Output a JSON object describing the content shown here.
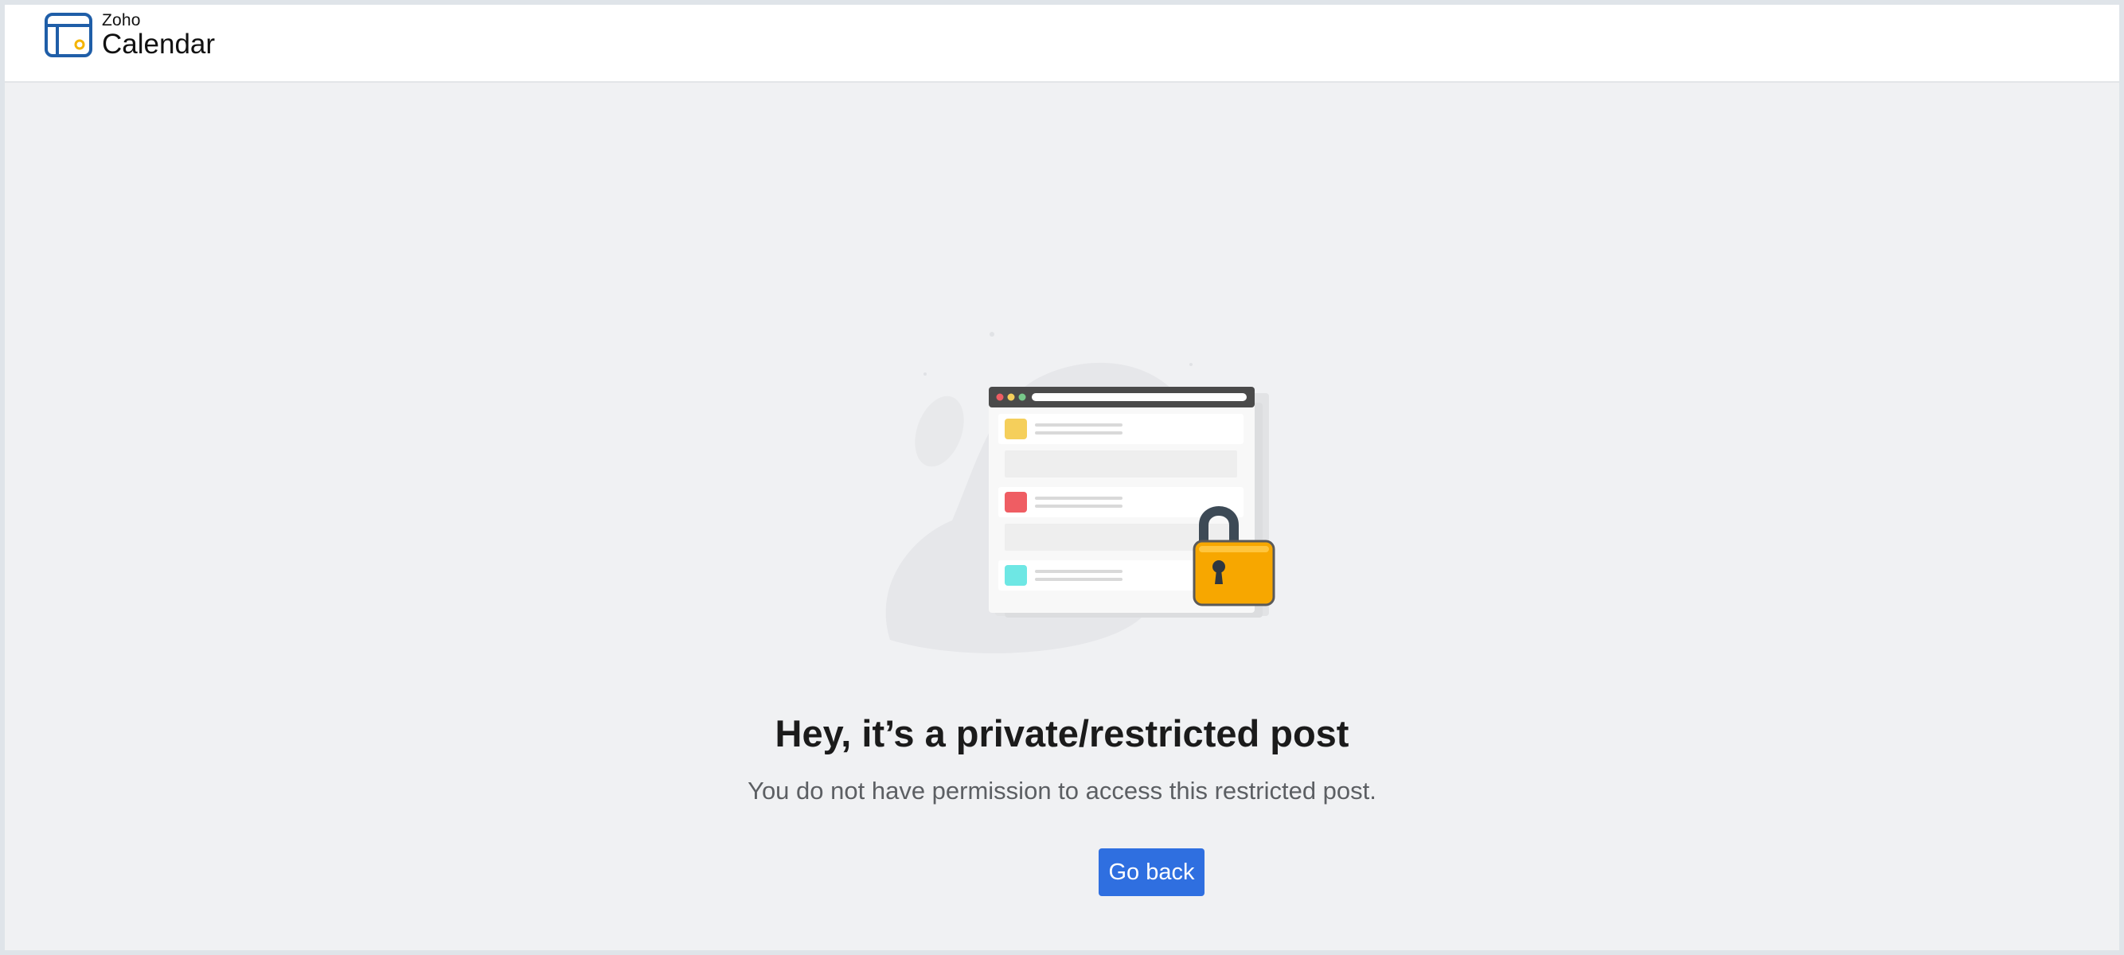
{
  "brand": {
    "company": "Zoho",
    "product": "Calendar",
    "logo_icon": "zoho-calendar-logo",
    "colors": {
      "logo_stroke": "#1f5ea8",
      "logo_accent": "#f4b400"
    }
  },
  "message": {
    "title": "Hey, it’s a private/restricted post",
    "description": "You do not have permission to access this restricted post."
  },
  "actions": {
    "go_back_label": "Go back"
  },
  "illustration": {
    "icons": [
      "browser-window-icon",
      "padlock-icon"
    ],
    "colors": {
      "padlock": "#f7a700",
      "padlock_shackle": "#3d4a56",
      "item_1": "#f5cf5b",
      "item_2": "#ef5d63",
      "item_3": "#6ee7e4",
      "window_bar": "#4a4a4a"
    }
  },
  "colors": {
    "page_background": "#f0f1f3",
    "header_background": "#ffffff",
    "button_primary": "#2f6fe0"
  }
}
